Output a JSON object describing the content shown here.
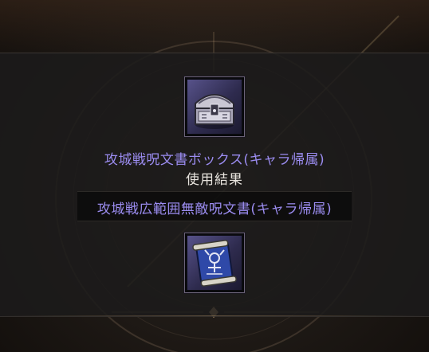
{
  "dialog": {
    "source_item_name": "攻城戦呪文書ボックス(キャラ帰属)",
    "result_label": "使用結果",
    "result_item_name": "攻城戦広範囲無敵呪文書(キャラ帰属)"
  },
  "icons": {
    "source_item": "treasure-chest-icon",
    "result_item": "scroll-icon"
  },
  "colors": {
    "item_name": "#9b8cf0",
    "label": "#e8e4de",
    "slot_background": "#3e3a6a",
    "ornament": "#b89a6a"
  }
}
